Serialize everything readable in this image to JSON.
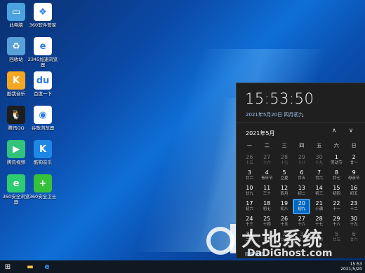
{
  "desktop": {
    "icons": [
      {
        "label": "此电脑",
        "color": "#4aa3df",
        "glyph": "▭",
        "icon": "computer-icon"
      },
      {
        "label": "360软件管家",
        "color": "#ffffff",
        "glyph": "❖",
        "icon": "360-software-manager-icon"
      },
      {
        "label": "回收站",
        "color": "#5aa0d8",
        "glyph": "♻",
        "icon": "recycle-bin-icon"
      },
      {
        "label": "2345加速浏览器",
        "color": "#ffffff",
        "glyph": "e",
        "icon": "2345-browser-icon"
      },
      {
        "label": "酷我音乐",
        "color": "#f5a623",
        "glyph": "K",
        "icon": "kuwo-music-icon"
      },
      {
        "label": "百度一下",
        "color": "#ffffff",
        "glyph": "du",
        "icon": "baidu-icon"
      },
      {
        "label": "腾讯QQ",
        "color": "#1d1d1d",
        "glyph": "🐧",
        "icon": "qq-icon"
      },
      {
        "label": "谷歌浏览器",
        "color": "#ffffff",
        "glyph": "◉",
        "icon": "chrome-icon"
      },
      {
        "label": "腾讯视频",
        "color": "#31c27c",
        "glyph": "▶",
        "icon": "tencent-video-icon"
      },
      {
        "label": "酷狗音乐",
        "color": "#1e88e5",
        "glyph": "K",
        "icon": "kugou-music-icon"
      },
      {
        "label": "360安全浏览器",
        "color": "#2ecc71",
        "glyph": "e",
        "icon": "360-browser-icon"
      },
      {
        "label": "360安全卫士",
        "color": "#36c13a",
        "glyph": "+",
        "icon": "360-security-icon"
      }
    ]
  },
  "calendar": {
    "time": "15:53:50",
    "full_date": "2021年5月20日 四月初九",
    "month_label": "2021年5月",
    "nav_up": "∧",
    "nav_down": "∨",
    "weekdays": [
      "一",
      "二",
      "三",
      "四",
      "五",
      "六",
      "日"
    ],
    "days": [
      {
        "d": "26",
        "l": "十五",
        "dim": true
      },
      {
        "d": "27",
        "l": "十六",
        "dim": true
      },
      {
        "d": "28",
        "l": "十七",
        "dim": true
      },
      {
        "d": "29",
        "l": "十八",
        "dim": true
      },
      {
        "d": "30",
        "l": "十九",
        "dim": true
      },
      {
        "d": "1",
        "l": "劳动节",
        "dim": false
      },
      {
        "d": "2",
        "l": "廿一",
        "dim": false
      },
      {
        "d": "3",
        "l": "廿二",
        "dim": false
      },
      {
        "d": "4",
        "l": "青年节",
        "dim": false
      },
      {
        "d": "5",
        "l": "立夏",
        "dim": false
      },
      {
        "d": "6",
        "l": "廿五",
        "dim": false
      },
      {
        "d": "7",
        "l": "廿六",
        "dim": false
      },
      {
        "d": "8",
        "l": "廿七",
        "dim": false
      },
      {
        "d": "9",
        "l": "母亲节",
        "dim": false
      },
      {
        "d": "10",
        "l": "廿九",
        "dim": false
      },
      {
        "d": "11",
        "l": "三十",
        "dim": false
      },
      {
        "d": "12",
        "l": "四月",
        "dim": false
      },
      {
        "d": "13",
        "l": "初二",
        "dim": false
      },
      {
        "d": "14",
        "l": "初三",
        "dim": false
      },
      {
        "d": "15",
        "l": "初四",
        "dim": false
      },
      {
        "d": "16",
        "l": "初五",
        "dim": false
      },
      {
        "d": "17",
        "l": "初六",
        "dim": false
      },
      {
        "d": "18",
        "l": "初七",
        "dim": false
      },
      {
        "d": "19",
        "l": "初八",
        "dim": false
      },
      {
        "d": "20",
        "l": "初九",
        "dim": false,
        "today": true
      },
      {
        "d": "21",
        "l": "小满",
        "dim": false
      },
      {
        "d": "22",
        "l": "十一",
        "dim": false
      },
      {
        "d": "23",
        "l": "十二",
        "dim": false
      },
      {
        "d": "24",
        "l": "十三",
        "dim": false
      },
      {
        "d": "25",
        "l": "十四",
        "dim": false
      },
      {
        "d": "26",
        "l": "十五",
        "dim": false
      },
      {
        "d": "27",
        "l": "十六",
        "dim": false
      },
      {
        "d": "28",
        "l": "十七",
        "dim": false
      },
      {
        "d": "29",
        "l": "十八",
        "dim": false
      },
      {
        "d": "30",
        "l": "十九",
        "dim": false
      },
      {
        "d": "31",
        "l": "二十",
        "dim": false
      },
      {
        "d": "1",
        "l": "廿一",
        "dim": true
      },
      {
        "d": "2",
        "l": "廿二",
        "dim": true
      },
      {
        "d": "3",
        "l": "廿三",
        "dim": true
      },
      {
        "d": "4",
        "l": "廿四",
        "dim": true
      },
      {
        "d": "5",
        "l": "廿五",
        "dim": true
      },
      {
        "d": "6",
        "l": "廿六",
        "dim": true
      }
    ],
    "hide_agenda": "隐藏日程"
  },
  "watermark": {
    "big": "大地系统",
    "small": "DaDiGhost.com"
  },
  "taskbar": {
    "start_glyph": "⊞",
    "folder_glyph": "▬",
    "browser_glyph": "e",
    "tray_time": "15:53",
    "tray_date": "2021/5/20"
  }
}
